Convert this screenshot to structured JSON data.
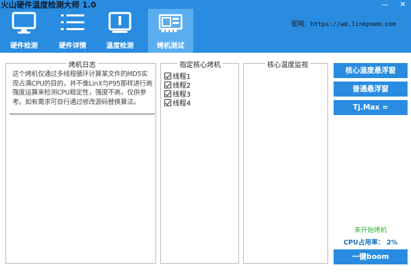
{
  "window": {
    "title": "火山硬件温度检测大师 1.0",
    "minimize": "—",
    "close": "✕"
  },
  "tabs": [
    {
      "label": "硬件检测",
      "icon": "monitor-icon"
    },
    {
      "label": "硬件详情",
      "icon": "list-icon"
    },
    {
      "label": "温度检测",
      "icon": "thermometer-monitor-icon"
    },
    {
      "label": "烤机测试",
      "icon": "graphics-card-icon"
    }
  ],
  "site": {
    "label": "官网：",
    "url": "https://wd.linkpoem.com"
  },
  "log_panel": {
    "title": "烤机日志",
    "text": "这个烤机仅通过多线程循环计算某文件的MD5实现占满CPU的目的，并不像LinX与P95那样进行高强度运算来检测CPU稳定性，强度不高，仅供参考。如有需求可自行通过修改源码替换算法。"
  },
  "thread_panel": {
    "title": "指定核心烤机",
    "threads": [
      "线程1",
      "线程2",
      "线程3",
      "线程4"
    ]
  },
  "temp_panel": {
    "title": "核心温度监视"
  },
  "buttons": {
    "core_float": "核心温度悬浮窗",
    "normal_float": "普通悬浮窗",
    "tjmax": "Tj.Max ="
  },
  "status": {
    "state": "未开始烤机",
    "cpu_usage": "CPU占用率： 2%",
    "state_color": "#2bb02b",
    "usage_color": "#1a6fc4"
  },
  "action": {
    "boom": "一键boom"
  },
  "colors": {
    "accent": "#2a8ce0",
    "active_tab": "#5aaef0"
  }
}
